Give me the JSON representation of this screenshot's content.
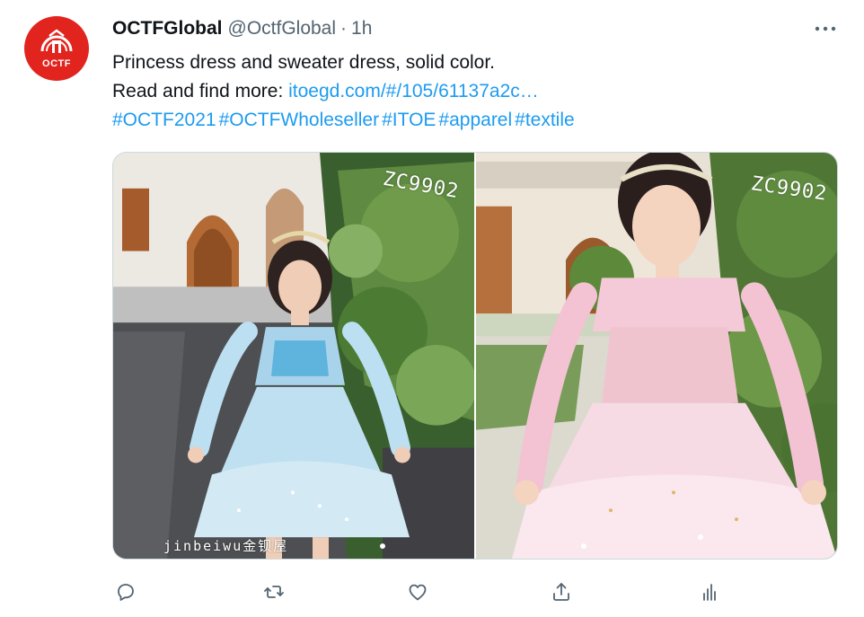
{
  "tweet": {
    "avatar_text": "OCTF",
    "display_name": "OCTFGlobal",
    "handle": "@OctfGlobal",
    "separator": "·",
    "time": "1h",
    "more_icon": "more-horizontal-icon",
    "text_line1": "Princess dress and sweater dress, solid color.",
    "read_more_prefix": "Read and find more: ",
    "link_text": "itoegd.com/#/105/61137a2c…",
    "hashtags": [
      "#OCTF2021",
      "#OCTFWholeseller",
      "#ITOE",
      "#apparel",
      "#textile"
    ]
  },
  "media": {
    "photos": [
      {
        "code": "ZC9902",
        "watermark": "jinbeiwu金钡屋"
      },
      {
        "code": "ZC9902"
      }
    ]
  },
  "actions": [
    {
      "name": "reply",
      "icon": "reply-icon"
    },
    {
      "name": "retweet",
      "icon": "retweet-icon"
    },
    {
      "name": "like",
      "icon": "like-icon"
    },
    {
      "name": "share",
      "icon": "share-icon"
    },
    {
      "name": "analytics",
      "icon": "analytics-icon"
    }
  ],
  "colors": {
    "accent": "#1d9bf0",
    "secondary_text": "#536471",
    "brand_red": "#e2241f"
  }
}
